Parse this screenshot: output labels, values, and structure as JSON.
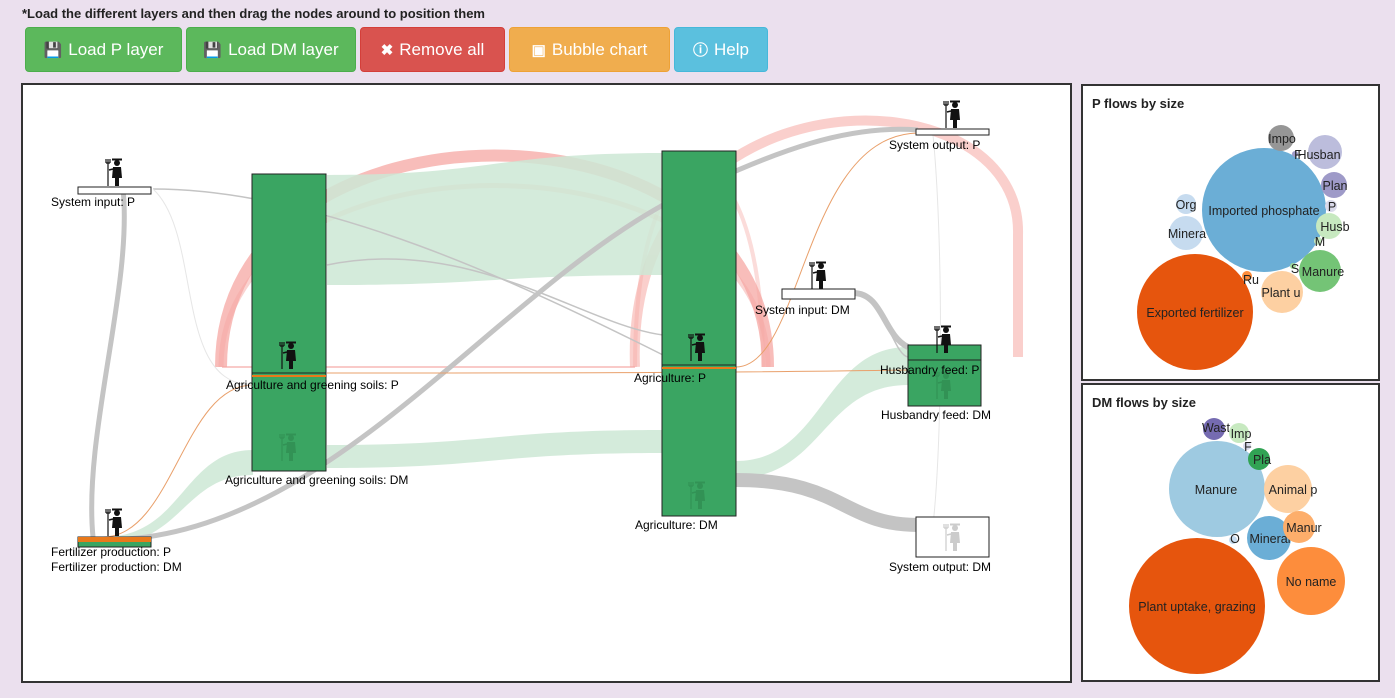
{
  "instructions": "*Load the different layers and then drag the nodes around to position them",
  "toolbar": {
    "load_p": {
      "label": "Load P layer",
      "icon": "floppy-icon"
    },
    "load_dm": {
      "label": "Load DM layer",
      "icon": "floppy-icon"
    },
    "remove_all": {
      "label": "Remove all",
      "icon": "floppy-remove-icon"
    },
    "bubble_chart": {
      "label": "Bubble chart",
      "icon": "picture-icon"
    },
    "help": {
      "label": "Help",
      "icon": "info-icon"
    }
  },
  "colors": {
    "green_button": "#5cb85c",
    "red_button": "#d9534f",
    "orange_button": "#f0ad4e",
    "blue_button": "#5bc0de",
    "node_green": "#3aa562",
    "flow_green": "#cde8d5",
    "flow_red": "#f5a7a3",
    "flow_gray": "#c8c8c8",
    "fertilizer_orange": "#e9791b"
  },
  "sankey": {
    "nodes": {
      "system_input_p": "System input: P",
      "agri_greening_p": "Agriculture and greening soils: P",
      "agri_greening_dm": "Agriculture and greening soils: DM",
      "fertilizer_p": "Fertilizer production: P",
      "fertilizer_dm": "Fertilizer production: DM",
      "agriculture_p": "Agriculture: P",
      "agriculture_dm": "Agriculture: DM",
      "system_input_dm": "System input: DM",
      "system_output_p": "System output: P",
      "husbandry_p": "Husbandry feed: P",
      "husbandry_dm": "Husbandry feed: DM",
      "system_output_dm": "System output: DM"
    }
  },
  "p_bubbles": {
    "title": "P flows by size",
    "labels": {
      "imported_phosphate": "Imported phosphate",
      "exported_fertilizer": "Exported fertilizer",
      "manure": "Manure",
      "plant_u": "Plant u",
      "minera": "Minera",
      "org": "Org",
      "impo": "Impo",
      "husban": "Husban",
      "f": "F",
      "plan": "Plan",
      "p": "P",
      "husb": "Husb",
      "m": "M",
      "ru": "Ru",
      "s": "S"
    }
  },
  "dm_bubbles": {
    "title": "DM flows by size",
    "labels": {
      "plant_uptake": "Plant uptake, grazing",
      "manure": "Manure",
      "no_name": "No name",
      "mineral": "Mineral",
      "animal_p": "Animal p",
      "manur": "Manur",
      "wast": "Wast",
      "imp": "Imp",
      "f": "F",
      "pla": "Pla",
      "o": "O"
    }
  }
}
